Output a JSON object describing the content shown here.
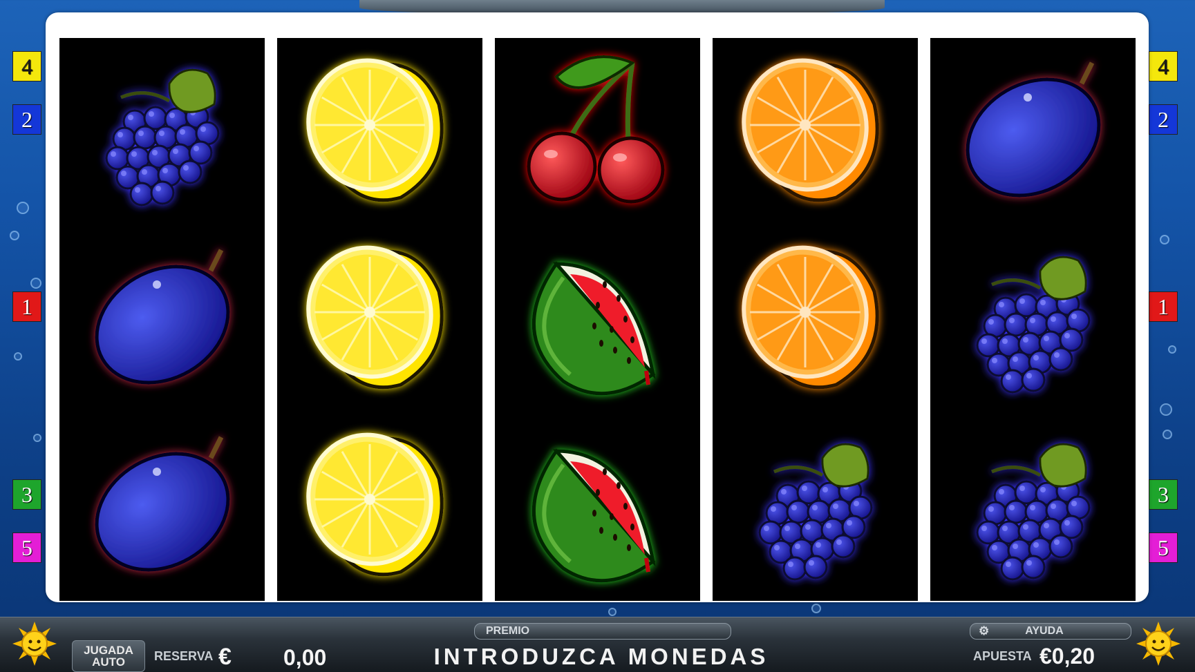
{
  "lines": {
    "left": [
      {
        "num": "4",
        "color": "#f4e70c",
        "text": "#1a1a1a"
      },
      {
        "num": "2",
        "color": "#1437d8",
        "text": "#ffffff"
      },
      {
        "num": "1",
        "color": "#e11818",
        "text": "#ffffff"
      },
      {
        "num": "3",
        "color": "#1ea52c",
        "text": "#ffffff"
      },
      {
        "num": "5",
        "color": "#e41ed6",
        "text": "#ffffff"
      }
    ],
    "right": [
      {
        "num": "4",
        "color": "#f4e70c",
        "text": "#1a1a1a"
      },
      {
        "num": "2",
        "color": "#1437d8",
        "text": "#ffffff"
      },
      {
        "num": "1",
        "color": "#e11818",
        "text": "#ffffff"
      },
      {
        "num": "3",
        "color": "#1ea52c",
        "text": "#ffffff"
      },
      {
        "num": "5",
        "color": "#e41ed6",
        "text": "#ffffff"
      }
    ]
  },
  "reels": [
    [
      "grapes",
      "plum",
      "plum"
    ],
    [
      "lemon",
      "lemon",
      "lemon"
    ],
    [
      "cherry",
      "watermelon",
      "watermelon"
    ],
    [
      "orange",
      "orange",
      "grapes"
    ],
    [
      "plum",
      "grapes",
      "grapes"
    ]
  ],
  "symbol_glow": {
    "grapes": "#3a33ff",
    "plum": "#c02040",
    "lemon": "#ffe600",
    "cherry": "#ff1010",
    "watermelon": "#26d020",
    "orange": "#ff8a00"
  },
  "bottom_bar": {
    "auto_button": {
      "line1": "JUGADA",
      "line2": "AUTO"
    },
    "reserve_label": "RESERVA",
    "reserve_currency": "€",
    "reserve_value": "0,00",
    "premio_label": "PREMIO",
    "message": "INTRODUZCA MONEDAS",
    "help_label": "AYUDA",
    "help_icon": "gear-icon",
    "bet_label": "APUESTA",
    "bet_value": "€0,20"
  }
}
